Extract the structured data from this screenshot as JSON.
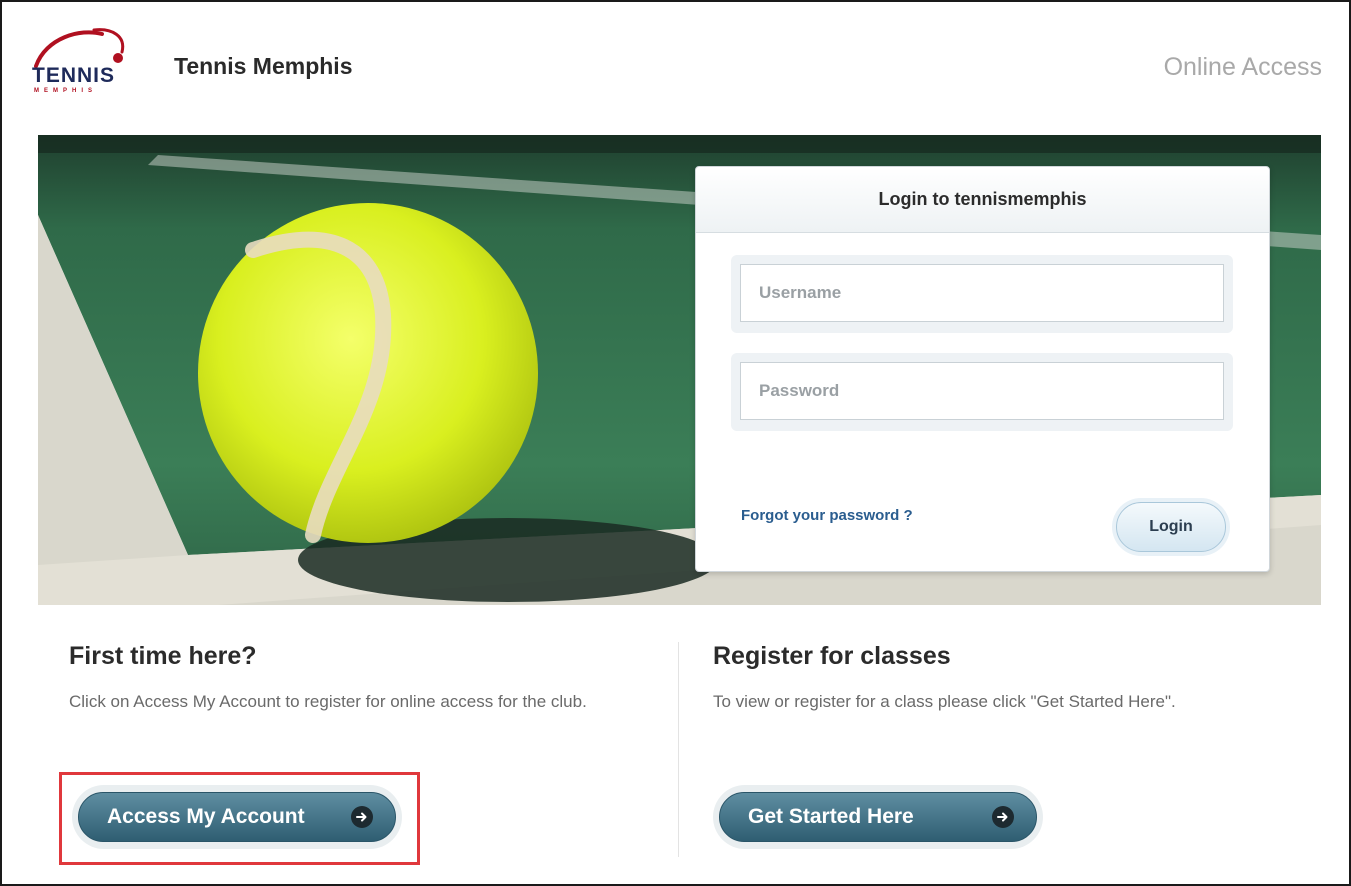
{
  "header": {
    "logo_text": "TENNIS",
    "logo_subtext": "MEMPHIS",
    "brand_title": "Tennis Memphis",
    "online_access_label": "Online Access"
  },
  "login": {
    "title": "Login to tennismemphis",
    "username_placeholder": "Username",
    "password_placeholder": "Password",
    "forgot_label": "Forgot your password ?",
    "login_button_label": "Login"
  },
  "first_time": {
    "heading": "First time here?",
    "description": "Click on Access My Account to register for online access for the club.",
    "button_label": "Access My Account"
  },
  "register": {
    "heading": "Register for classes",
    "description": "To view or register for a class please click \"Get Started Here\".",
    "button_label": "Get Started Here"
  },
  "colors": {
    "brand_red": "#b01020",
    "brand_navy": "#1e2a5a",
    "cta_teal": "#2f5e72",
    "link_blue": "#2a5d8f",
    "highlight_red": "#e0383c"
  }
}
